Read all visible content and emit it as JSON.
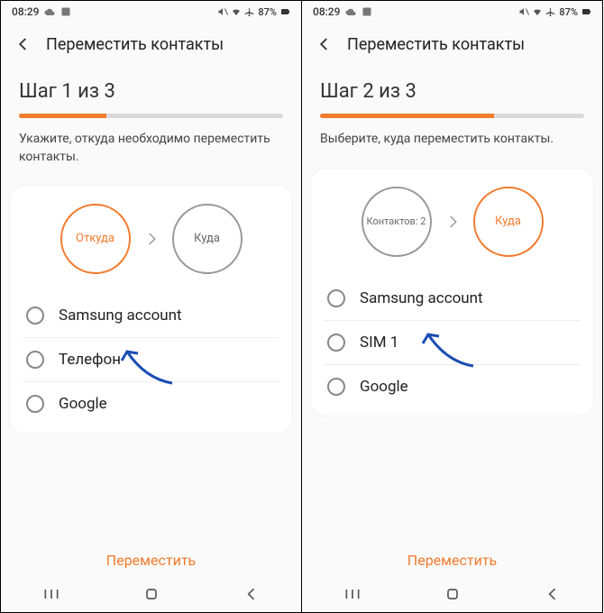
{
  "statusbar": {
    "time": "08:29",
    "battery": "87%"
  },
  "screens": [
    {
      "title": "Переместить контакты",
      "step_label": "Шаг 1 из 3",
      "progress_pct": 33,
      "instruction": "Укажите, откуда необходимо переместить контакты.",
      "circle_left": {
        "text": "Откуда",
        "active": true
      },
      "circle_right": {
        "text": "Куда",
        "active": false
      },
      "options": [
        {
          "label": "Samsung account"
        },
        {
          "label": "Телефон"
        },
        {
          "label": "Google"
        }
      ],
      "arrow_target": "Телефон",
      "action_label": "Переместить"
    },
    {
      "title": "Переместить контакты",
      "step_label": "Шаг 2 из 3",
      "progress_pct": 66,
      "instruction": "Выберите, куда переместить контакты.",
      "circle_left": {
        "text": "Контактов: 2",
        "active": false,
        "small": true
      },
      "circle_right": {
        "text": "Куда",
        "active": true
      },
      "options": [
        {
          "label": "Samsung account"
        },
        {
          "label": "SIM 1"
        },
        {
          "label": "Google"
        }
      ],
      "arrow_target": "SIM 1",
      "action_label": "Переместить"
    }
  ]
}
